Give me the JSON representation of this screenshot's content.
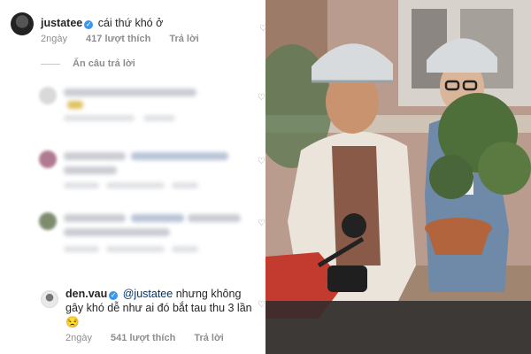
{
  "top_comment": {
    "username": "justatee",
    "text": "cái thứ khó ở",
    "time": "2ngày",
    "likes": "417 lượt thích",
    "reply": "Trả lời"
  },
  "hide_replies": "Ẩn câu trả lời",
  "reply_comment": {
    "username": "den.vau",
    "mention": "@justatee",
    "text": "nhưng không gây khó dễ như ai đó bắt tau thu 3 lần 😒",
    "time": "2ngày",
    "likes": "541 lượt thích",
    "reply": "Trả lời"
  },
  "icons": {
    "verified": "verified-badge-icon",
    "like": "heart-icon"
  },
  "colors": {
    "verified": "#3897f0",
    "meta_text": "#8e8e8e",
    "mention": "#003569"
  }
}
